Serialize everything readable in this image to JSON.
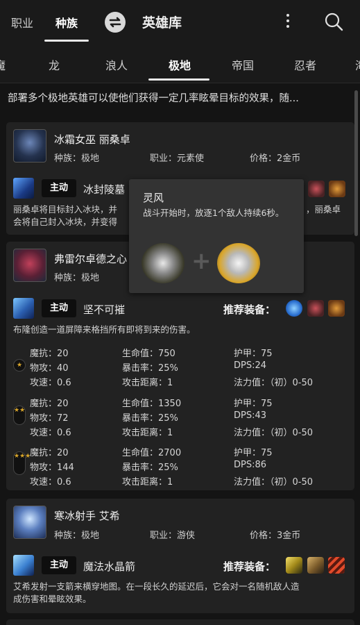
{
  "header": {
    "tabs": [
      {
        "label": "职业"
      },
      {
        "label": "种族"
      }
    ],
    "active_tab": "种族",
    "title": "英雄库",
    "icons": [
      "swap-icon",
      "more-vertical-icon",
      "search-icon"
    ]
  },
  "races": {
    "items": [
      {
        "label": "魔"
      },
      {
        "label": "龙"
      },
      {
        "label": "浪人"
      },
      {
        "label": "极地"
      },
      {
        "label": "帝国"
      },
      {
        "label": "忍者"
      },
      {
        "label": "海"
      }
    ],
    "active": "极地"
  },
  "race_description": "部署多个极地英雄可以使他们获得一定几率眩晕目标的效果，随...",
  "labels": {
    "race_prefix": "种族：",
    "class_prefix": "职业：",
    "price_prefix": "价格：",
    "active": "主动",
    "recommended": "推荐装备："
  },
  "heroes": [
    {
      "name": "冰霜女巫  丽桑卓",
      "race": "种族：极地",
      "class": "职业：元素使",
      "price": "价格：2金币",
      "skill_tag": "主动",
      "skill_name": "冰封陵墓",
      "skill_desc_line1": "丽桑卓将目标封入冰块，并",
      "skill_desc_line1_right": "，丽桑卓",
      "skill_desc_line2": "会将自己封入冰块，并变得"
    },
    {
      "name": "弗雷尔卓德之心",
      "race": "种族：极地",
      "skill_tag": "主动",
      "skill_name": "坚不可摧",
      "recommended_label": "推荐装备：",
      "skill_desc": "布隆创造一道屏障来格挡所有即将到来的伤害。",
      "stats": [
        {
          "stars": "★",
          "magic_resist": "魔抗：20",
          "hp": "生命值：750",
          "armor": "护甲：75",
          "attack": "物攻：40",
          "crit": "暴击率：25%",
          "dps": "DPS:24",
          "attack_speed": "攻速：0.6",
          "range": "攻击距离：1",
          "mana": "法力值：（初）0-50"
        },
        {
          "stars": "★★",
          "magic_resist": "魔抗：20",
          "hp": "生命值：1350",
          "armor": "护甲：75",
          "attack": "物攻：72",
          "crit": "暴击率：25%",
          "dps": "DPS:43",
          "attack_speed": "攻速：0.6",
          "range": "攻击距离：1",
          "mana": "法力值：（初）0-50"
        },
        {
          "stars": "★★★",
          "magic_resist": "魔抗：20",
          "hp": "生命值：2700",
          "armor": "护甲：75",
          "attack": "物攻：144",
          "crit": "暴击率：25%",
          "dps": "DPS:86",
          "attack_speed": "攻速：0.6",
          "range": "攻击距离：1",
          "mana": "法力值：（初）0-50"
        }
      ]
    },
    {
      "name": "寒冰射手  艾希",
      "race": "种族：极地",
      "class": "职业：游侠",
      "price": "价格：3金币",
      "skill_tag": "主动",
      "skill_name": "魔法水晶箭",
      "recommended_label": "推荐装备：",
      "skill_desc_line1": "艾希发射一支箭来横穿地图。在一段长久的延迟后，它会对一名随机敌人造",
      "skill_desc_line2": "成伤害和晕眩效果。"
    }
  ],
  "tooltip": {
    "title": "灵风",
    "desc": "战斗开始时，放逐1个敌人持续6秒。",
    "components": [
      "gauntlet-icon",
      "cloak-icon"
    ],
    "plus": "+"
  }
}
